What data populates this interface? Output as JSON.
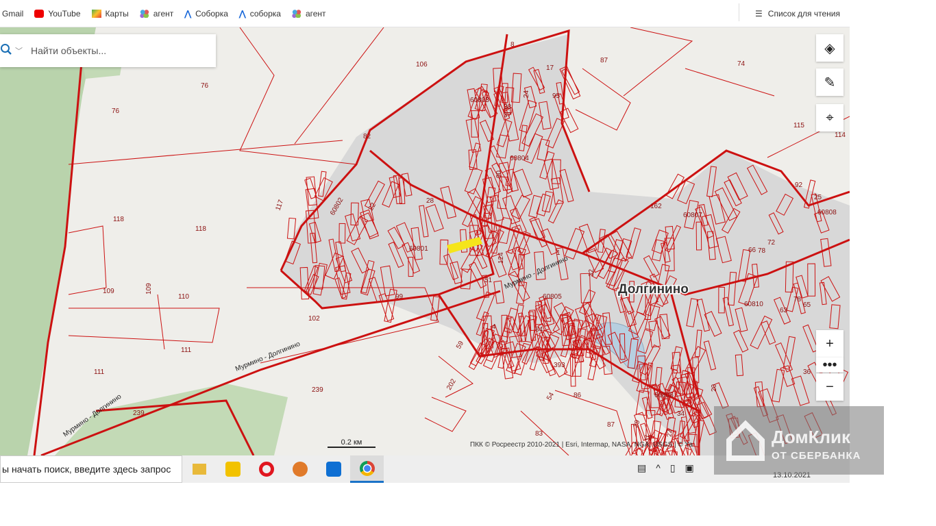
{
  "bookmarks": [
    {
      "label": "Gmail",
      "icon": "gmail-icon"
    },
    {
      "label": "YouTube",
      "icon": "youtube-icon"
    },
    {
      "label": "Карты",
      "icon": "maps-icon"
    },
    {
      "label": "агент",
      "icon": "agent-icon"
    },
    {
      "label": "Соборка",
      "icon": "soborka-icon"
    },
    {
      "label": "соборка",
      "icon": "soborka-icon"
    },
    {
      "label": "агент",
      "icon": "agent-icon"
    }
  ],
  "reading_list": "Список для чтения",
  "map": {
    "search_placeholder": "Найти объекты...",
    "scale": "0.2 км",
    "attribution": "ПКК © Росреестр 2010-2021 | Esri, Intermap, NASA, NGA, USGS | © Ya",
    "village": "Долгинино",
    "roads": [
      "Мурмино - Долгинино",
      "Мурмино - Долгинино",
      "Мурмино - Долгинино"
    ],
    "parcel_labels": [
      "106",
      "76",
      "76",
      "87",
      "74",
      "115",
      "114",
      "8",
      "17",
      "24",
      "95",
      "60803",
      "38",
      "37",
      "82",
      "60804",
      "90",
      "118",
      "118",
      "117",
      "60802",
      "22",
      "28",
      "162",
      "60807",
      "25",
      "92",
      "60808",
      "60801",
      "66",
      "78",
      "72",
      "109",
      "109",
      "110",
      "99",
      "51",
      "124",
      "32",
      "60805",
      "60810",
      "78",
      "65",
      "63",
      "102",
      "4",
      "84",
      "111",
      "111",
      "59",
      "393",
      "239",
      "202",
      "86",
      "36",
      "20",
      "60806",
      "34",
      "22",
      "239",
      "54",
      "83",
      "87",
      "29",
      "19",
      "1"
    ],
    "colors": {
      "parcel": "#cc1111",
      "built": "#d8d8d8",
      "forest": "#b9d3ac",
      "water": "#b7cfe0"
    }
  },
  "taskbar": {
    "search": "ы начать поиск, введите здесь запрос",
    "apps": [
      "file-explorer",
      "player",
      "opera",
      "eye-app",
      "teamviewer",
      "chrome"
    ],
    "date": "13.10.2021"
  },
  "watermark": {
    "title": "ДомКлик",
    "subtitle": "ОТ СБЕРБАНКА"
  }
}
